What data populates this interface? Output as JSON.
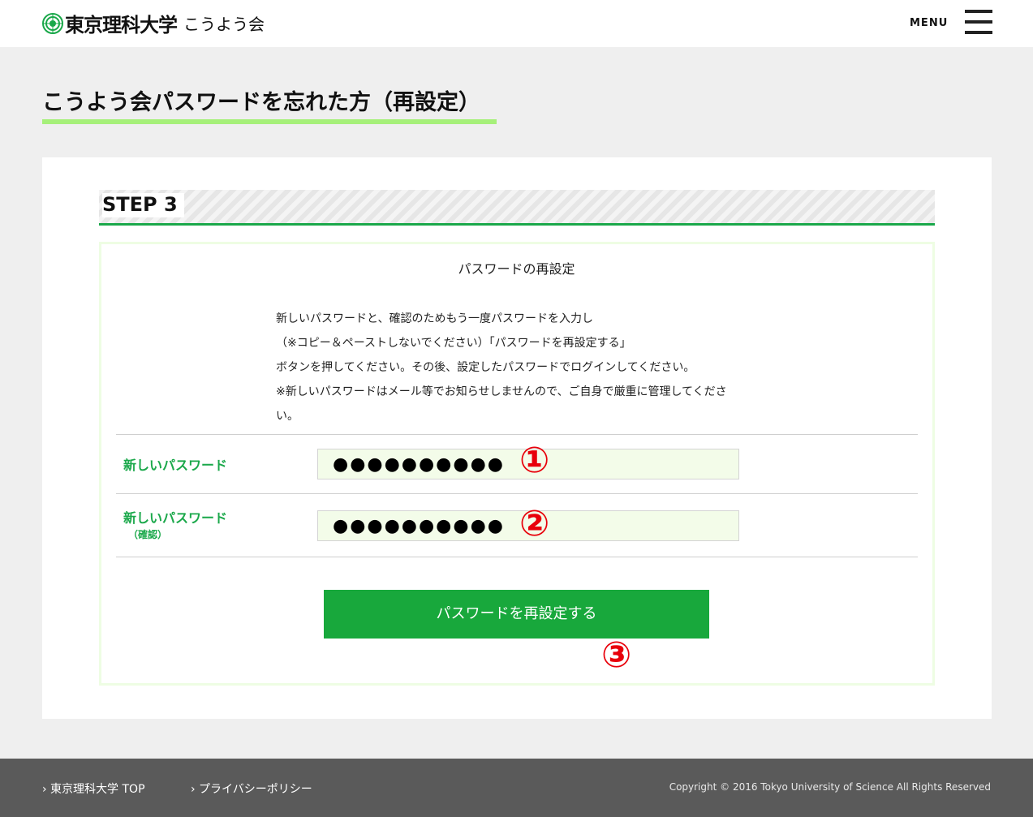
{
  "header": {
    "logo_name": "東京理科大学",
    "logo_sub": "こうよう会",
    "menu_label": "MENU"
  },
  "page": {
    "title": "こうよう会パスワードを忘れた方（再設定）"
  },
  "step": {
    "label": "STEP 3",
    "heading": "パスワードの再設定",
    "instructions": [
      "新しいパスワードと、確認のためもう一度パスワードを入力し",
      "（※コピー＆ペーストしないでください）「パスワードを再設定する」",
      "ボタンを押してください。その後、設定したパスワードでログインしてください。",
      "※新しいパスワードはメール等でお知らせしませんので、ご自身で厳重に管理してくださ",
      "い。"
    ]
  },
  "form": {
    "new_password_label": "新しいパスワード",
    "new_password_value": "●●●●●●●●●●",
    "confirm_password_label": "新しいパスワード",
    "confirm_password_sub": "（確認）",
    "confirm_password_value": "●●●●●●●●●●",
    "submit_label": "パスワードを再設定する"
  },
  "annotations": {
    "marker_1": "①",
    "marker_2": "②",
    "marker_3": "③"
  },
  "footer": {
    "link_top": "› 東京理科大学 TOP",
    "link_privacy": "› プライバシーポリシー",
    "copyright": "Copyright © 2016 Tokyo University of Science All Rights Reserved"
  },
  "colors": {
    "accent_green": "#18a83c",
    "title_underline": "#a6f07a",
    "marker_red": "#e8000b"
  }
}
